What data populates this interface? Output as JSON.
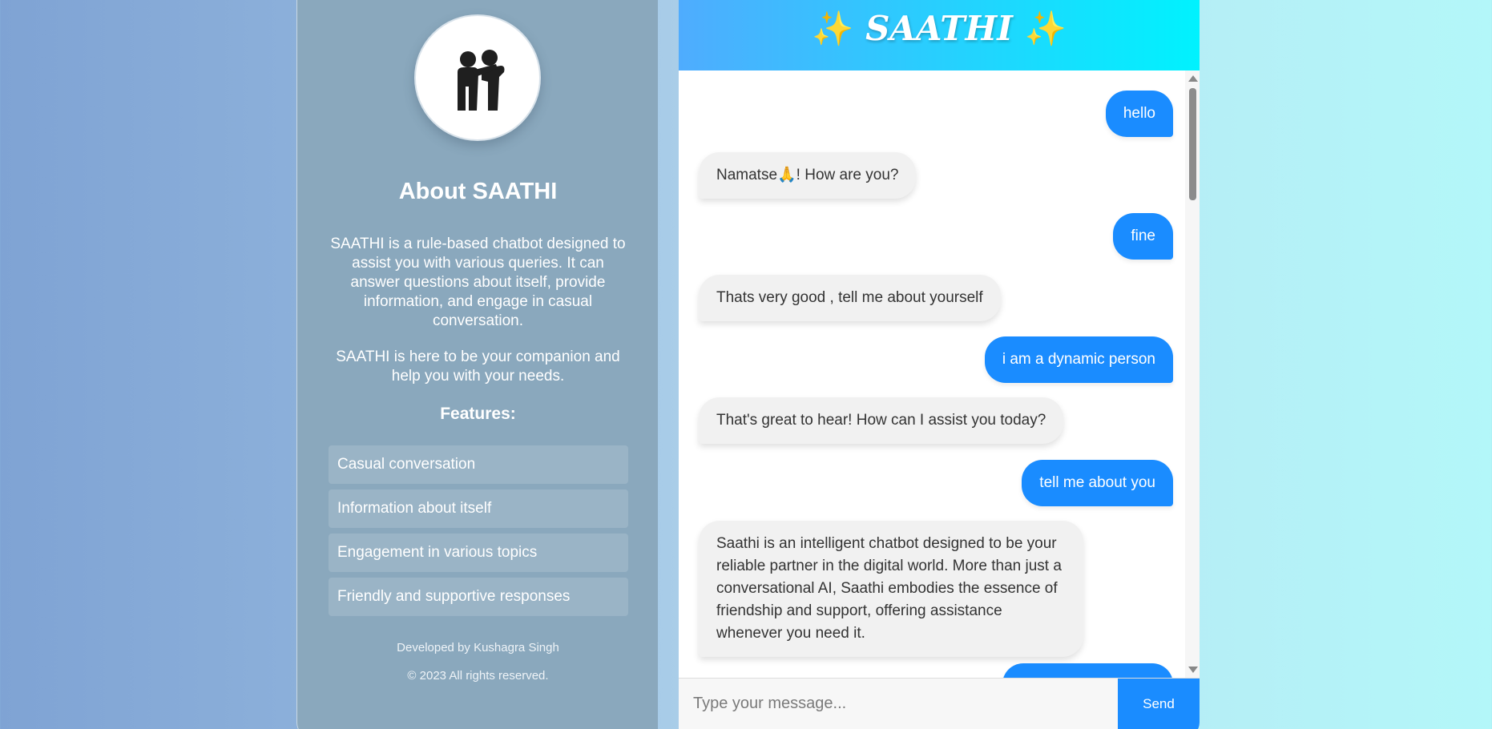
{
  "about": {
    "avatar_icon": "two-people-icon",
    "title": "About SAATHI",
    "description": "SAATHI is a rule-based chatbot designed to assist you with various queries. It can answer questions about itself, provide information, and engage in casual conversation.",
    "tagline": "SAATHI is here to be your companion and help you with your needs.",
    "features_title": "Features:",
    "features": [
      "Casual conversation",
      "Information about itself",
      "Engagement in various topics",
      "Friendly and supportive responses"
    ],
    "credit": "Developed by Kushagra Singh",
    "copyright": "© 2023 All rights reserved."
  },
  "chat": {
    "header": {
      "star": "✨",
      "title": "SAATHI"
    },
    "messages": [
      {
        "from": "user",
        "text": "hello"
      },
      {
        "from": "bot",
        "text": "Namatse🙏! How are you?"
      },
      {
        "from": "user",
        "text": "fine"
      },
      {
        "from": "bot",
        "text": "Thats very good , tell me about yourself"
      },
      {
        "from": "user",
        "text": "i am a dynamic person"
      },
      {
        "from": "bot",
        "text": "That's great to hear! How can I assist you today?"
      },
      {
        "from": "user",
        "text": "tell me about you"
      },
      {
        "from": "bot",
        "text": "Saathi is an intelligent chatbot designed to be your reliable partner in the digital world. More than just a conversational AI, Saathi embodies the essence of friendship and support, offering assistance whenever you need it."
      }
    ],
    "input": {
      "placeholder": "Type your message...",
      "value": ""
    },
    "send_label": "Send"
  },
  "colors": {
    "accent": "#1a8cff",
    "header_gradient_start": "#4facfe",
    "header_gradient_end": "#00f2fe",
    "sidebar_bg": "#8aa8bd",
    "bot_bubble": "#f1f1f1"
  }
}
